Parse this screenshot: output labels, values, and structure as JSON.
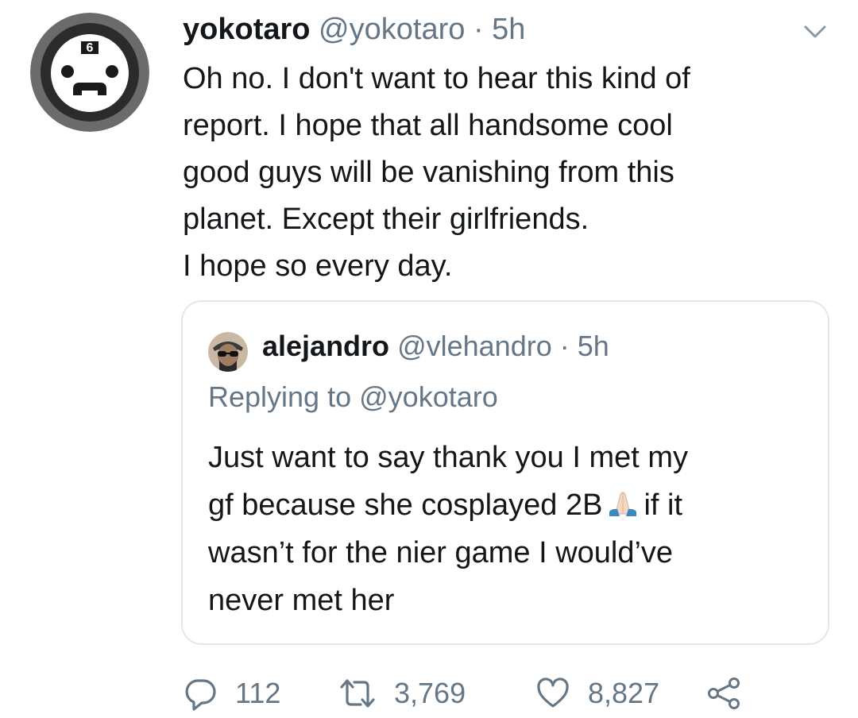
{
  "tweet": {
    "author": {
      "name": "yokotaro",
      "handle": "@yokotaro",
      "separator": "·",
      "time": "5h",
      "avatar_icon": "emil-mask-avatar-icon",
      "avatar_badge": "6"
    },
    "menu_icon": "chevron-down-icon",
    "body_lines": [
      "Oh no. I don't want to hear this kind of",
      "report. I hope that all handsome cool",
      "good guys will be vanishing from this",
      "planet. Except their girlfriends.",
      "I hope so every day."
    ]
  },
  "quote": {
    "author": {
      "name": "alejandro",
      "handle": "@vlehandro",
      "separator": "·",
      "time": "5h",
      "avatar_icon": "user-photo-avatar-icon"
    },
    "replying_prefix": "Replying to",
    "replying_to": "@yokotaro",
    "body": {
      "line1": "Just want to say thank you I met my",
      "line2_before": "gf because she cosplayed 2B",
      "line2_emoji": "folded-hands-emoji",
      "line2_after": "if it",
      "line3": "wasn’t for the nier game I would’ve",
      "line4": "never met her"
    }
  },
  "actions": {
    "reply": {
      "icon": "reply-bubble-icon",
      "count": "112"
    },
    "retweet": {
      "icon": "retweet-icon",
      "count": "3,769"
    },
    "like": {
      "icon": "heart-icon",
      "count": "8,827"
    },
    "share": {
      "icon": "share-icon"
    }
  },
  "colors": {
    "text": "#14171a",
    "muted": "#657786",
    "border": "#e1e8ed"
  }
}
